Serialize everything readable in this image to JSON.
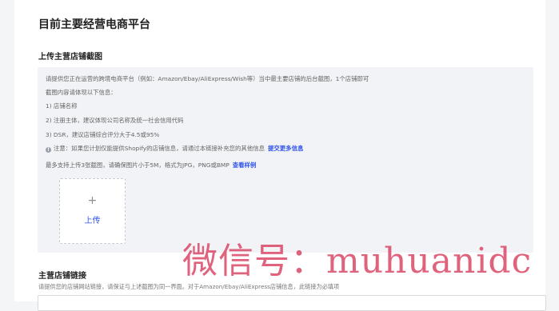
{
  "section": {
    "title": "目前主要经营电商平台"
  },
  "upload_section": {
    "title": "上传主营店铺截图",
    "instructions": [
      "请提供您正在运营的跨境电商平台（例如：Amazon/Ebay/AliExpress/Wish等）当中最主要店铺的后台截图，1个店铺即可",
      "截图内容请体现以下信息：",
      "1) 店铺名称",
      "2) 注册主体，建议体现公司名称及统一社会信用代码",
      "3) DSR，建议店铺综合评分大于4.5或95%"
    ],
    "note_text": "注意：如果您计划仅能提供Shopify的店铺信息，请通过本链接补充您的其他信息",
    "note_link": "提交更多信息",
    "limit_text": "最多支持上传3张截图，请确保图片小于5M，格式为JPG，PNG或BMP",
    "limit_link": "查看样例",
    "upload_plus": "+",
    "upload_label": "上传"
  },
  "store_link": {
    "title": "主营店铺链接",
    "description": "请提供您的店铺网站链接，请保证与上述截图为同一界面。对于Amazon/Ebay/AliExpress店铺信息，此链接为必填项",
    "value": ""
  },
  "watermark": {
    "text": "微信号：muhuanidc"
  }
}
